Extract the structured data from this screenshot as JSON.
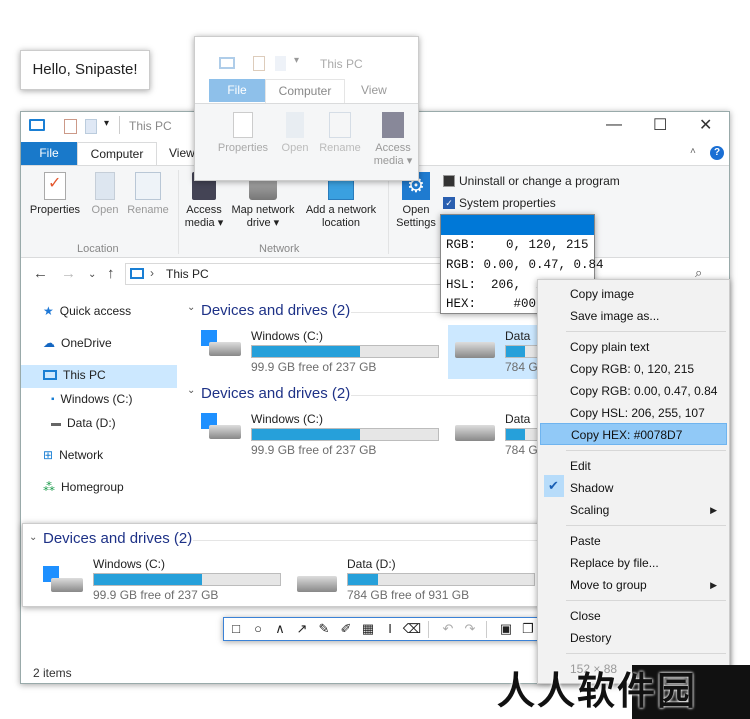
{
  "hello": {
    "text": "Hello, Snipaste!"
  },
  "window": {
    "title": "This PC",
    "tabs": {
      "file": "File",
      "computer": "Computer",
      "view": "View"
    },
    "ribbon": {
      "properties": "Properties",
      "open": "Open",
      "rename": "Rename",
      "access_media": "Access media",
      "map_network_drive": "Map network drive",
      "add_network_location": "Add a network location",
      "open_settings": "Open Settings",
      "uninstall": "Uninstall or change a program",
      "system_properties": "System properties",
      "group_location": "Location",
      "group_network": "Network"
    },
    "address": "This PC",
    "nav": {
      "quick_access": "Quick access",
      "onedrive": "OneDrive",
      "this_pc": "This PC",
      "windows_c": "Windows (C:)",
      "data_d": "Data (D:)",
      "network": "Network",
      "homegroup": "Homegroup"
    },
    "section_header": "Devices and drives (2)",
    "drive_c": {
      "name": "Windows (C:)",
      "free": "99.9 GB free of 237 GB",
      "used_pct": 58
    },
    "drive_d": {
      "name": "Data (D:)",
      "free": "784 GB free of 931 GB",
      "used_pct": 16
    },
    "drive_d_short": {
      "name": "Data",
      "free": "784 G"
    },
    "status": "2 items"
  },
  "ghost": {
    "title": "This PC",
    "tabs": {
      "file": "File",
      "computer": "Computer",
      "view": "View"
    },
    "buttons": {
      "properties": "Properties",
      "open": "Open",
      "rename": "Rename",
      "access_media": "Access media"
    }
  },
  "picker": {
    "color": "#0078d7",
    "rgb": "RGB:    0, 120, 215",
    "rgbf": "RGB: 0.00, 0.47, 0.84",
    "hsl": "HSL:  206,  255, 107",
    "hex": "HEX:     #0078D7"
  },
  "search_fragment": "C",
  "menu": {
    "copy_image": "Copy image",
    "save_image_as": "Save image as...",
    "copy_plain_text": "Copy plain text",
    "copy_rgb": "Copy RGB: 0, 120, 215",
    "copy_rgbf": "Copy RGB: 0.00, 0.47, 0.84",
    "copy_hsl": "Copy HSL: 206, 255, 107",
    "copy_hex": "Copy HEX: #0078D7",
    "edit": "Edit",
    "shadow": "Shadow",
    "scaling": "Scaling",
    "paste": "Paste",
    "replace_by_file": "Replace by file...",
    "move_to_group": "Move to group",
    "close": "Close",
    "destroy": "Destory",
    "dims": "152 × 88"
  },
  "watermark": "人人软件园"
}
